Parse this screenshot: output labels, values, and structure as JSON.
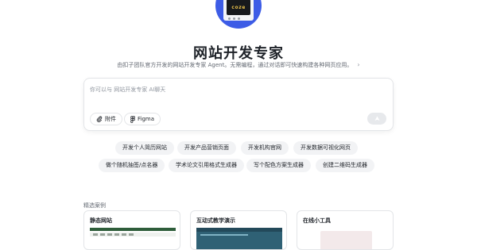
{
  "logo": {
    "text": "coze"
  },
  "header": {
    "title": "网站开发专家",
    "subtitle": "由扣子团队官方开发的网站开发专家 Agent。无需编程，通过对话即可快速构建各种网页应用。"
  },
  "chat": {
    "placeholder": "你可以与 网站开发专家 AI聊天",
    "value": "",
    "attach_label": "附件",
    "figma_label": "Figma"
  },
  "suggestions": {
    "row1": [
      "开发个人简历网站",
      "开发产品营销页面",
      "开发机构官网",
      "开发数据可视化网页"
    ],
    "row2": [
      "做个随机抽签/点名器",
      "学术论文引用格式生成器",
      "写个配色方案生成器",
      "创建二维码生成器"
    ]
  },
  "showcase": {
    "label": "精选案例",
    "cards": [
      {
        "title": "静态网站"
      },
      {
        "title": "互动式教学演示"
      },
      {
        "title": "在线小工具"
      }
    ]
  },
  "colors": {
    "brand_blue": "#3d5ce6",
    "chip_bg": "#f2f3f5",
    "send_disabled": "#e7e9ec"
  }
}
